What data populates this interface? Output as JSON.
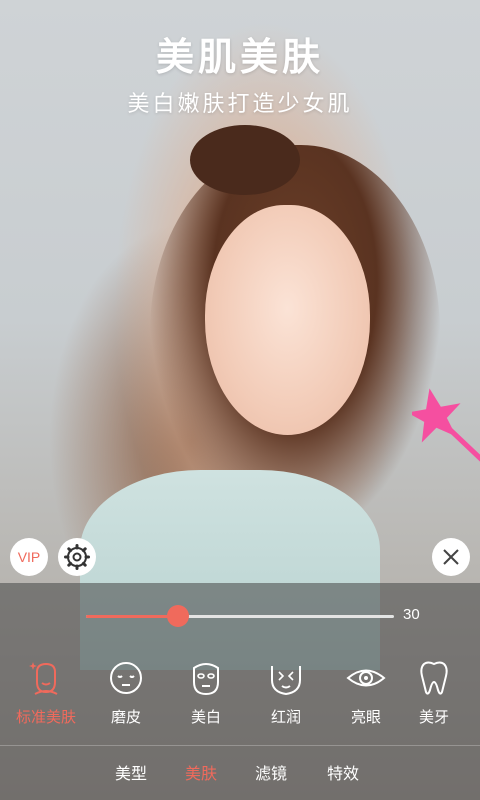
{
  "hero": {
    "title": "美肌美肤",
    "subtitle": "美白嫩肤打造少女肌"
  },
  "controls": {
    "vip_label": "VIP",
    "settings_icon": "gear-icon",
    "close_icon": "close-icon"
  },
  "slider": {
    "value": 30,
    "value_label": "30",
    "fill_fraction": 0.3
  },
  "tools": [
    {
      "label": "标准美肤",
      "icon": "face-sparkle-icon",
      "active": true
    },
    {
      "label": "磨皮",
      "icon": "smooth-face-icon",
      "active": false
    },
    {
      "label": "美白",
      "icon": "whitening-mask-icon",
      "active": false
    },
    {
      "label": "红润",
      "icon": "rosy-face-icon",
      "active": false
    },
    {
      "label": "亮眼",
      "icon": "eye-icon",
      "active": false
    },
    {
      "label": "美牙",
      "icon": "tooth-icon",
      "active": false
    }
  ],
  "tabs": [
    {
      "label": "美型",
      "active": false
    },
    {
      "label": "美肤",
      "active": true
    },
    {
      "label": "滤镜",
      "active": false
    },
    {
      "label": "特效",
      "active": false
    }
  ],
  "colors": {
    "accent": "#f06a5c",
    "panel": "#464646",
    "text": "#ffffff"
  }
}
